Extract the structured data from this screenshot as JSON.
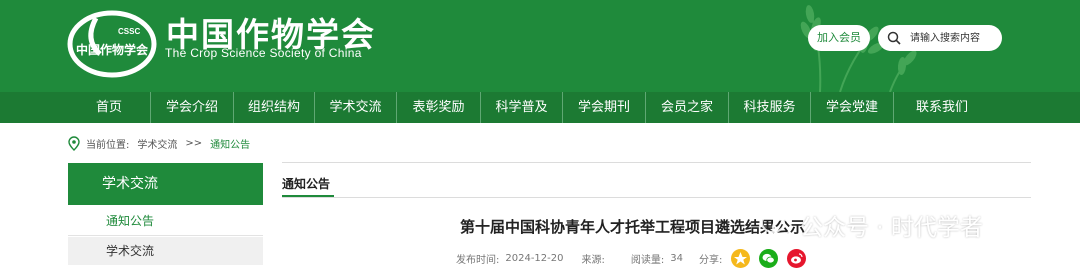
{
  "header": {
    "logo_cn": "中国作物学会",
    "logo_en": "The Crop Science Society of China",
    "logo_mark_text": "CSSC",
    "join_label": "加入会员",
    "search_placeholder": "请输入搜索内容"
  },
  "nav": {
    "items": [
      {
        "label": "首页"
      },
      {
        "label": "学会介绍"
      },
      {
        "label": "组织结构"
      },
      {
        "label": "学术交流"
      },
      {
        "label": "表彰奖励"
      },
      {
        "label": "科学普及"
      },
      {
        "label": "学会期刊"
      },
      {
        "label": "会员之家"
      },
      {
        "label": "科技服务"
      },
      {
        "label": "学会党建"
      },
      {
        "label": "联系我们"
      }
    ]
  },
  "breadcrumb": {
    "prefix": "当前位置:",
    "level1": "学术交流",
    "sep": ">>",
    "current": "通知公告"
  },
  "sidebar": {
    "heading": "学术交流",
    "items": [
      {
        "label": "通知公告"
      },
      {
        "label": "学术交流"
      }
    ]
  },
  "content": {
    "tab_label": "通知公告",
    "title": "第十届中国科协青年人才托举工程项目遴选结果公示",
    "publish_label": "发布时间:",
    "publish_date": "2024-12-20",
    "source_label": "来源:",
    "reads_label": "阅读量:",
    "reads_value": "34",
    "share_label": "分享:"
  },
  "watermark": {
    "text": "公众号 · 时代学者"
  },
  "colors": {
    "brand_green": "#1f8a3b",
    "nav_green": "#1c7a33"
  }
}
